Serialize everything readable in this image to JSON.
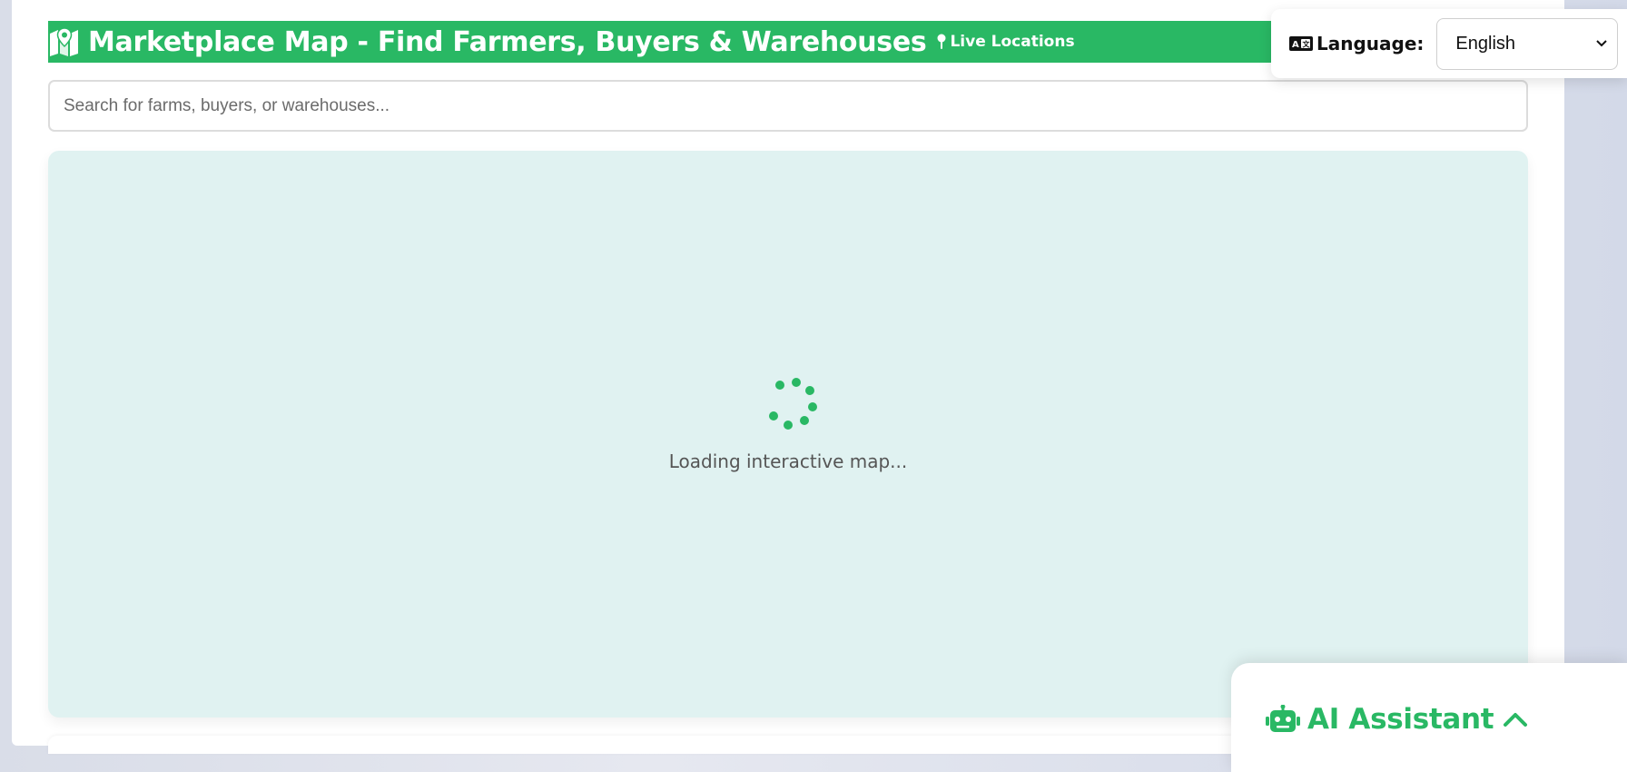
{
  "header": {
    "title": "Marketplace Map - Find Farmers, Buyers & Warehouses",
    "badge": "Live Locations",
    "icon": "map-icon",
    "badge_icon": "pin-icon"
  },
  "search": {
    "placeholder": "Search for farms, buyers, or warehouses...",
    "value": ""
  },
  "map": {
    "loading_text": "Loading interactive map...",
    "spinner_icon": "spinner-icon"
  },
  "language": {
    "label": "Language:",
    "selected": "English",
    "icon": "language-icon"
  },
  "assistant": {
    "title": "AI Assistant",
    "icon": "robot-icon",
    "toggle_icon": "chevron-up-icon"
  },
  "colors": {
    "accent": "#29b864",
    "map_background": "#e0f2f1",
    "page_background": "#ffffff"
  }
}
